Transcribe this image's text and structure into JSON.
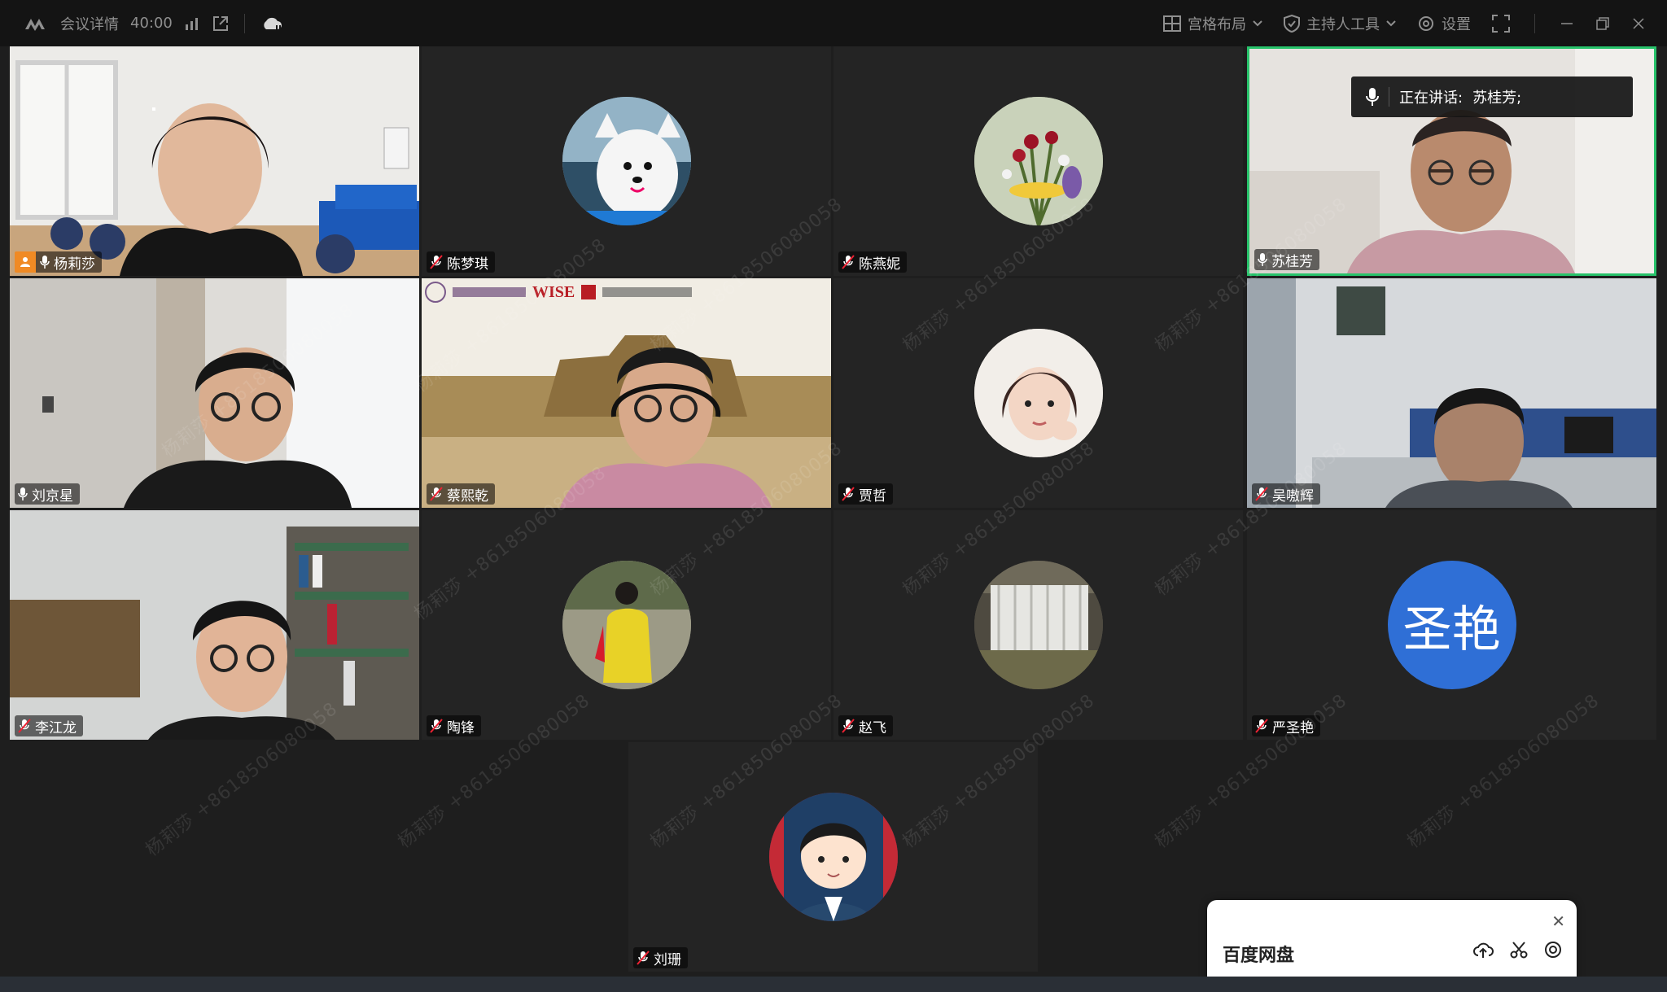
{
  "topbar": {
    "meeting_details": "会议详情",
    "timer": "40:00",
    "layout_label": "宫格布局",
    "host_tools_label": "主持人工具",
    "settings_label": "设置"
  },
  "speaking_popup": {
    "label": "正在讲话:",
    "name": "苏桂芳;"
  },
  "participants": [
    {
      "name": "杨莉莎"
    },
    {
      "name": "陈梦琪"
    },
    {
      "name": "陈燕妮"
    },
    {
      "name": "苏桂芳"
    },
    {
      "name": "刘京星"
    },
    {
      "name": "蔡熙乾"
    },
    {
      "name": "贾哲"
    },
    {
      "name": "吴嗷辉"
    },
    {
      "name": "李江龙"
    },
    {
      "name": "陶锋"
    },
    {
      "name": "赵飞"
    },
    {
      "name": "严圣艳",
      "avatar_text": "圣艳"
    },
    {
      "name": "刘珊"
    }
  ],
  "banner": {
    "wise": "WISE"
  },
  "watermark": "杨莉莎 +8618506080058",
  "netdisk": {
    "title": "百度网盘"
  },
  "colors": {
    "speaking_border": "#28c36b",
    "host_badge": "#f08a24",
    "avatar_blue": "#2f6fd6"
  }
}
